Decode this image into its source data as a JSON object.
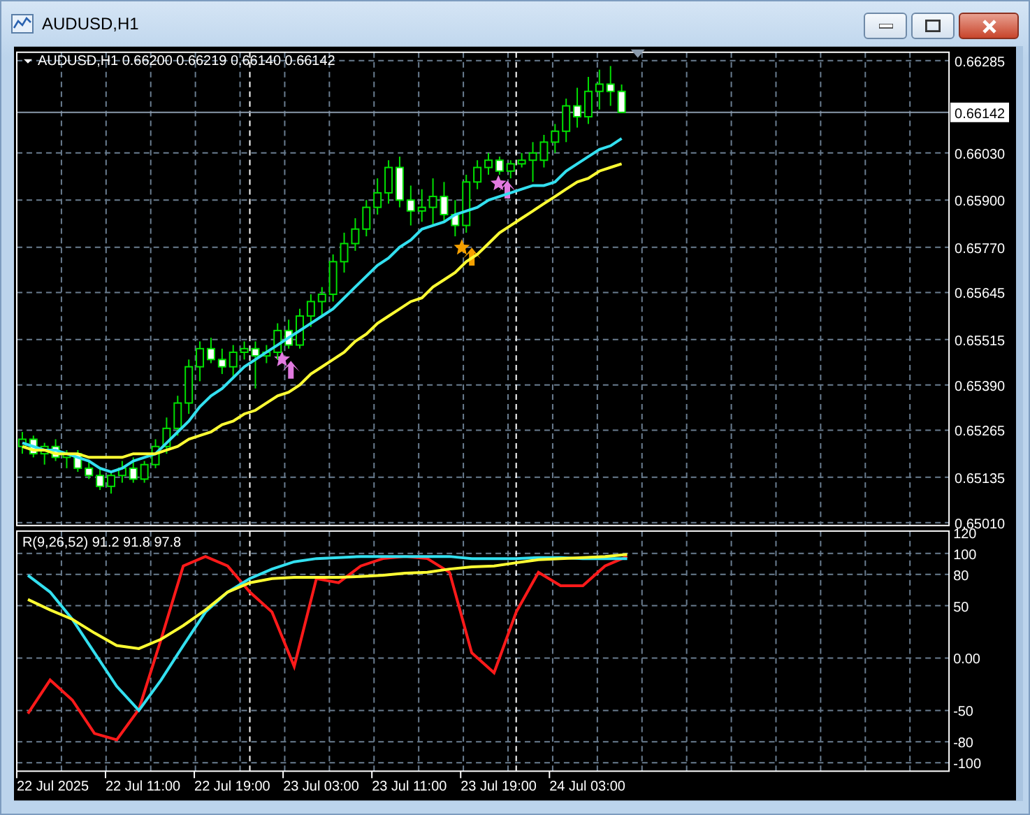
{
  "window": {
    "title": "AUDUSD,H1"
  },
  "time_axis": {
    "labels": [
      "22 Jul 2025",
      "22 Jul 11:00",
      "22 Jul 19:00",
      "23 Jul 03:00",
      "23 Jul 11:00",
      "23 Jul 19:00",
      "24 Jul 03:00"
    ]
  },
  "price_chart": {
    "legend": "AUDUSD,H1 0.66200 0.66219 0.66140 0.66142",
    "current_price": "0.66142",
    "chart_data": {
      "type": "candlestick",
      "grid": true,
      "ref_lines": [
        {
          "axis": "y",
          "value": 0.66142
        }
      ],
      "categories": [
        null,
        null,
        null,
        null,
        null,
        null,
        null,
        null,
        null,
        null,
        null,
        null,
        null,
        null,
        null,
        null,
        null,
        null,
        null,
        null,
        null,
        null,
        null,
        null,
        null,
        null,
        null,
        null,
        null,
        null,
        null,
        null,
        null,
        null,
        null,
        null,
        null,
        null,
        null,
        null,
        null,
        null,
        null,
        null,
        null,
        null,
        null,
        null,
        null,
        null,
        null,
        null,
        null,
        null,
        null,
        null,
        null,
        null,
        null,
        null,
        null,
        null,
        null,
        null,
        null,
        null,
        null,
        null,
        null,
        null,
        null,
        null,
        null,
        null,
        null,
        null,
        null,
        null,
        null,
        null,
        null,
        null,
        null,
        null
      ],
      "ylim": [
        0.65002,
        0.66308
      ],
      "yticks": [
        {
          "value": 0.66285,
          "label": "0.66285"
        },
        {
          "value": 0.6603,
          "label": "0.66030"
        },
        {
          "value": 0.659,
          "label": "0.65900"
        },
        {
          "value": 0.6577,
          "label": "0.65770"
        },
        {
          "value": 0.65645,
          "label": "0.65645"
        },
        {
          "value": 0.65515,
          "label": "0.65515"
        },
        {
          "value": 0.6539,
          "label": "0.65390"
        },
        {
          "value": 0.65265,
          "label": "0.65265"
        },
        {
          "value": 0.65135,
          "label": "0.65135"
        },
        {
          "value": 0.6501,
          "label": "0.65010"
        }
      ],
      "ohlc": [
        [
          0.6522,
          0.6526,
          0.652,
          0.6524
        ],
        [
          0.6524,
          0.6525,
          0.6519,
          0.652
        ],
        [
          0.652,
          0.6523,
          0.6517,
          0.6522
        ],
        [
          0.6522,
          0.6524,
          0.6518,
          0.6519
        ],
        [
          0.6519,
          0.6521,
          0.6516,
          0.652
        ],
        [
          0.652,
          0.6521,
          0.6515,
          0.6516
        ],
        [
          0.6516,
          0.6518,
          0.6513,
          0.6514
        ],
        [
          0.6514,
          0.6516,
          0.651,
          0.6511
        ],
        [
          0.6511,
          0.6515,
          0.6509,
          0.6514
        ],
        [
          0.6514,
          0.6518,
          0.6512,
          0.6516
        ],
        [
          0.6516,
          0.6519,
          0.6512,
          0.6513
        ],
        [
          0.6513,
          0.6518,
          0.6512,
          0.6517
        ],
        [
          0.6517,
          0.6524,
          0.6516,
          0.6522
        ],
        [
          0.6522,
          0.653,
          0.652,
          0.6527
        ],
        [
          0.6527,
          0.6536,
          0.6525,
          0.6534
        ],
        [
          0.6534,
          0.6546,
          0.6531,
          0.6544
        ],
        [
          0.6544,
          0.6551,
          0.654,
          0.6549
        ],
        [
          0.6549,
          0.6552,
          0.6545,
          0.6546
        ],
        [
          0.6546,
          0.6549,
          0.6542,
          0.6544
        ],
        [
          0.6544,
          0.655,
          0.6541,
          0.6548
        ],
        [
          0.6548,
          0.6551,
          0.6546,
          0.6549
        ],
        [
          0.6549,
          0.6551,
          0.6538,
          0.6547
        ],
        [
          0.6547,
          0.655,
          0.6545,
          0.6548
        ],
        [
          0.6548,
          0.6556,
          0.6546,
          0.6554
        ],
        [
          0.6554,
          0.6557,
          0.6549,
          0.655
        ],
        [
          0.655,
          0.656,
          0.6549,
          0.6558
        ],
        [
          0.6558,
          0.6564,
          0.6555,
          0.6562
        ],
        [
          0.6562,
          0.6566,
          0.6558,
          0.6564
        ],
        [
          0.6564,
          0.6575,
          0.6562,
          0.6573
        ],
        [
          0.6573,
          0.6581,
          0.657,
          0.6578
        ],
        [
          0.6578,
          0.6585,
          0.6576,
          0.6582
        ],
        [
          0.6582,
          0.659,
          0.658,
          0.6588
        ],
        [
          0.6588,
          0.6596,
          0.6586,
          0.6592
        ],
        [
          0.6592,
          0.6601,
          0.6589,
          0.6599
        ],
        [
          0.6599,
          0.6602,
          0.6588,
          0.659
        ],
        [
          0.659,
          0.6594,
          0.6583,
          0.6587
        ],
        [
          0.6587,
          0.6593,
          0.6584,
          0.6588
        ],
        [
          0.6588,
          0.6596,
          0.6583,
          0.6591
        ],
        [
          0.6591,
          0.6595,
          0.6584,
          0.6586
        ],
        [
          0.6586,
          0.659,
          0.658,
          0.6583
        ],
        [
          0.6583,
          0.6597,
          0.6581,
          0.6595
        ],
        [
          0.6595,
          0.6601,
          0.6593,
          0.6599
        ],
        [
          0.6599,
          0.6603,
          0.6597,
          0.6601
        ],
        [
          0.6601,
          0.6602,
          0.6597,
          0.6598
        ],
        [
          0.6598,
          0.6601,
          0.6596,
          0.66
        ],
        [
          0.66,
          0.6603,
          0.6599,
          0.6601
        ],
        [
          0.6601,
          0.6606,
          0.6595,
          0.6603
        ],
        [
          0.6601,
          0.6608,
          0.6599,
          0.6606
        ],
        [
          0.6606,
          0.6611,
          0.6603,
          0.6609
        ],
        [
          0.6609,
          0.6618,
          0.6606,
          0.6616
        ],
        [
          0.6616,
          0.6621,
          0.661,
          0.6613
        ],
        [
          0.6613,
          0.6624,
          0.6611,
          0.662
        ],
        [
          0.662,
          0.6626,
          0.6615,
          0.6622
        ],
        [
          0.6622,
          0.6627,
          0.6616,
          0.662
        ],
        [
          0.662,
          0.66219,
          0.6614,
          0.66142
        ],
        null,
        null,
        null,
        null,
        null,
        null,
        null,
        null,
        null,
        null,
        null,
        null,
        null,
        null,
        null,
        null,
        null,
        null,
        null,
        null,
        null,
        null,
        null,
        null,
        null,
        null,
        null,
        null,
        null
      ],
      "series": [
        {
          "type": "line",
          "color": "#33e0f0",
          "values": [
            0.6523,
            0.6522,
            0.6521,
            0.6521,
            0.652,
            0.6519,
            0.6518,
            0.6516,
            0.6515,
            0.6516,
            0.6518,
            0.6519,
            0.652,
            0.6523,
            0.6526,
            0.6529,
            0.6533,
            0.6536,
            0.6538,
            0.6541,
            0.6544,
            0.6546,
            0.6548,
            0.655,
            0.6552,
            0.6554,
            0.6556,
            0.6558,
            0.656,
            0.6563,
            0.6566,
            0.6569,
            0.6572,
            0.6574,
            0.6577,
            0.6579,
            0.6582,
            0.6583,
            0.6584,
            0.6586,
            0.6587,
            0.6588,
            0.659,
            0.6591,
            0.6592,
            0.6593,
            0.6594,
            0.6594,
            0.6595,
            0.6598,
            0.66,
            0.6602,
            0.6604,
            0.6605,
            0.6607,
            null,
            null,
            null,
            null,
            null,
            null,
            null,
            null,
            null,
            null,
            null,
            null,
            null,
            null,
            null,
            null,
            null,
            null,
            null,
            null,
            null,
            null,
            null,
            null,
            null,
            null,
            null,
            null,
            null
          ]
        },
        {
          "type": "line",
          "color": "#ffff33",
          "values": [
            0.6522,
            0.6521,
            0.6521,
            0.652,
            0.652,
            0.652,
            0.6519,
            0.6519,
            0.6519,
            0.6519,
            0.652,
            0.652,
            0.652,
            0.6521,
            0.6522,
            0.6524,
            0.6525,
            0.6526,
            0.6528,
            0.6529,
            0.6531,
            0.6532,
            0.6534,
            0.6536,
            0.6537,
            0.6539,
            0.6542,
            0.6544,
            0.6546,
            0.6548,
            0.6551,
            0.6553,
            0.6556,
            0.6558,
            0.656,
            0.6562,
            0.6563,
            0.6566,
            0.6568,
            0.657,
            0.6573,
            0.6575,
            0.6578,
            0.6581,
            0.6583,
            0.6585,
            0.6587,
            0.6589,
            0.6591,
            0.6593,
            0.6595,
            0.6596,
            0.6598,
            0.6599,
            0.66,
            null,
            null,
            null,
            null,
            null,
            null,
            null,
            null,
            null,
            null,
            null,
            null,
            null,
            null,
            null,
            null,
            null,
            null,
            null,
            null,
            null,
            null,
            null,
            null,
            null,
            null,
            null,
            null,
            null
          ]
        }
      ]
    }
  },
  "indicator": {
    "legend": "R(9,26,52) 91.2 91.8 97.8",
    "chart_data": {
      "type": "line",
      "grid": true,
      "ylim": [
        -108,
        121.3
      ],
      "categories": [
        null,
        null,
        null,
        null,
        null,
        null,
        null,
        null,
        null,
        null,
        null,
        null,
        null,
        null,
        null,
        null,
        null,
        null,
        null,
        null,
        null,
        null,
        null,
        null,
        null,
        null,
        null,
        null,
        null,
        null,
        null,
        null,
        null,
        null,
        null,
        null,
        null,
        null,
        null,
        null,
        null,
        null
      ],
      "yticks": [
        {
          "value": 120,
          "label": "120"
        },
        {
          "value": 100,
          "label": "100"
        },
        {
          "value": 80,
          "label": "80"
        },
        {
          "value": 50,
          "label": "50"
        },
        {
          "value": 0,
          "label": "0.00"
        },
        {
          "value": -50,
          "label": "-50"
        },
        {
          "value": -80,
          "label": "-80"
        },
        {
          "value": -100,
          "label": "-100"
        }
      ],
      "series": [
        {
          "color": "#ff1a1a",
          "values": [
            -53,
            -21,
            -40,
            -72,
            -78,
            -49,
            18,
            88,
            97,
            88,
            63,
            44,
            -8,
            76,
            72,
            88,
            95,
            97,
            95,
            82,
            5,
            -14,
            44,
            82,
            69,
            69,
            88,
            97,
            null,
            null,
            null,
            null,
            null,
            null,
            null,
            null,
            null,
            null,
            null,
            null,
            null,
            null
          ]
        },
        {
          "color": "#33e0f0",
          "values": [
            79,
            63,
            37,
            5,
            -27,
            -50,
            -21,
            12,
            44,
            63,
            76,
            85,
            92,
            95,
            96,
            97,
            97,
            97,
            97,
            97,
            95,
            95,
            95,
            96,
            96,
            95,
            95,
            95,
            null,
            null,
            null,
            null,
            null,
            null,
            null,
            null,
            null,
            null,
            null,
            null,
            null,
            null
          ]
        },
        {
          "color": "#ffff33",
          "values": [
            56,
            46,
            37,
            24,
            12,
            9,
            18,
            31,
            46,
            63,
            72,
            76,
            77,
            77,
            77,
            78,
            79,
            81,
            82,
            85,
            87,
            88,
            91,
            94,
            95,
            96,
            97,
            99,
            null,
            null,
            null,
            null,
            null,
            null,
            null,
            null,
            null,
            null,
            null,
            null,
            null,
            null
          ]
        }
      ]
    }
  }
}
